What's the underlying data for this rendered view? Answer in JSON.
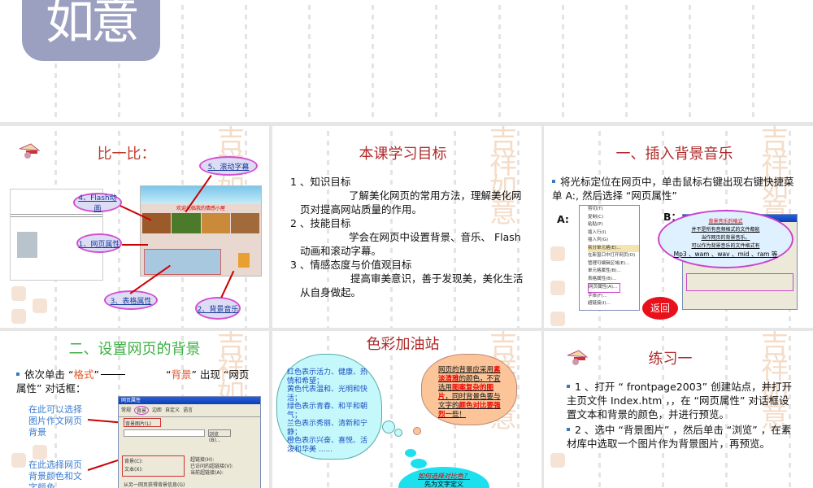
{
  "logo": {
    "glyphs": "如意"
  },
  "watermark": "吉祥如意",
  "slides": [
    {
      "title": "比一比：",
      "callouts": [
        "5、滚动字幕",
        "4、Flash动画",
        "1、网页属性",
        "3、表格属性",
        "2、背景音乐"
      ],
      "web_banner": "欢迎光临我的情感小屋"
    },
    {
      "title": "本课学习目标",
      "lines": [
        "1 、知识目标",
        "了解美化网页的常用方法，理解美化网页对提高网站质量的作用。",
        "2 、技能目标",
        "学会在网页中设置背景、音乐、 Flash 动画和滚动字幕。",
        "3 、情感态度与价值观目标",
        "提高审美意识，善于发现美，美化生活从自身做起。"
      ]
    },
    {
      "title": "一、插入背景音乐",
      "bullet": "将光标定位在网页中，单击鼠标右键出现右键快捷菜单 A:, 然后选择 “网页属性”",
      "label_a": "A:",
      "label_b": "B：",
      "menu": [
        "剪切(T)",
        "复制(C)",
        "粘贴(P)",
        "插入行(I)",
        "插入列(G)",
        "拆分单元格(E)...",
        "在新窗口中打开网页(O)",
        "管理可编辑区域(E)...",
        "单元格属性(B)...",
        "表格属性(B)...",
        "网页属性(A)...",
        "字体(F)...",
        "超链接(I)..."
      ],
      "bubble": [
        "背景音乐的格式",
        "并不是所有音频格式的文件都能",
        "当作网页的背景音乐。",
        "可以作为背景音乐的文件格式有",
        "Mp3 、wam 、wav 、mid 、ram 等"
      ],
      "back_button": "返回"
    },
    {
      "title": "二、设置网页的背景",
      "bullet_pre": "依次单击 “",
      "bullet_format": "格式",
      "bullet_mid": "”",
      "bullet_bg_q1": "“",
      "bullet_bg": "背景",
      "bullet_post": "” 出现 “网页属性” 对话框：",
      "note1": "在此可以选择图片作文网页背景",
      "note2": "在此选择网页背景颜色和文字颜色",
      "dialog": {
        "title": "网页属性",
        "tabs": [
          "常规",
          "背景",
          "边距",
          "自定义",
          "语言"
        ],
        "bg_picture": "背景图片(L)",
        "browse": "浏览(B)...",
        "bg_label": "背景(C):",
        "text_label": "文本(X):",
        "auto": "自动",
        "link": "超链接(H):",
        "visited": "已访问的超链接(V):",
        "active": "当前超链接(A):",
        "from_page": "从另一网页获得背景信息(G)"
      }
    },
    {
      "title": "色彩加油站",
      "left_cloud": [
        "红色表示活力、健康、热情和希望；",
        "黄色代表温和、光明和快活；",
        "绿色表示青春、和平和朝气；",
        "兰色表示秀丽、清新和宁静；",
        "橙色表示兴奋、喜悦、活泼和华美 ......"
      ],
      "right_cloud": [
        {
          "t": "网页的背景应采用",
          "r": false
        },
        {
          "t": "素淡清雅",
          "r": true
        },
        {
          "t": "的颜色，不宜选用",
          "r": false
        },
        {
          "t": "图案复杂的图片",
          "r": true
        },
        {
          "t": "，同时背景色要与文字的",
          "r": false
        },
        {
          "t": "颜色对比要强烈",
          "r": true
        },
        {
          "t": "一些！",
          "r": false
        }
      ],
      "bottom_cloud": [
        "如何选择对比色？",
        "先为文字定义"
      ]
    },
    {
      "title": "练习一",
      "bullets": [
        "1 、打开 “ frontpage2003” 创建站点，并打开主页文件 Index.htm ，，在 “网页属性” 对话框设置文本和背景的颜色，并进行预览。",
        "2 、选中 “背景图片” ，然后单击 “浏览” ，在素材库中选取一个图片作为背景图片，再预览。"
      ]
    }
  ]
}
